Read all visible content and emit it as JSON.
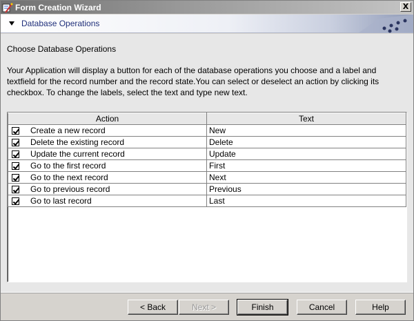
{
  "window": {
    "title": "Form Creation Wizard",
    "close_label": "X"
  },
  "banner": {
    "title": "Database Operations"
  },
  "content": {
    "heading": "Choose Database Operations",
    "description": "Your Application will display a button for each of the database operations you choose and a label and textfield for the record number and the record state.You can select or deselect an action by clicking its checkbox. To change the labels, select the text and type new text."
  },
  "table": {
    "headers": [
      "Action",
      "Text"
    ],
    "rows": [
      {
        "checked": true,
        "action": "Create a new record",
        "text": "New"
      },
      {
        "checked": true,
        "action": "Delete the existing record",
        "text": "Delete"
      },
      {
        "checked": true,
        "action": "Update the current record",
        "text": "Update"
      },
      {
        "checked": true,
        "action": "Go to the first record",
        "text": "First"
      },
      {
        "checked": true,
        "action": "Go to the next record",
        "text": "Next"
      },
      {
        "checked": true,
        "action": "Go to previous record",
        "text": "Previous"
      },
      {
        "checked": true,
        "action": "Go to last record",
        "text": "Last"
      }
    ]
  },
  "buttons": {
    "back": "< Back",
    "next": "Next >",
    "finish": "Finish",
    "cancel": "Cancel",
    "help": "Help"
  }
}
